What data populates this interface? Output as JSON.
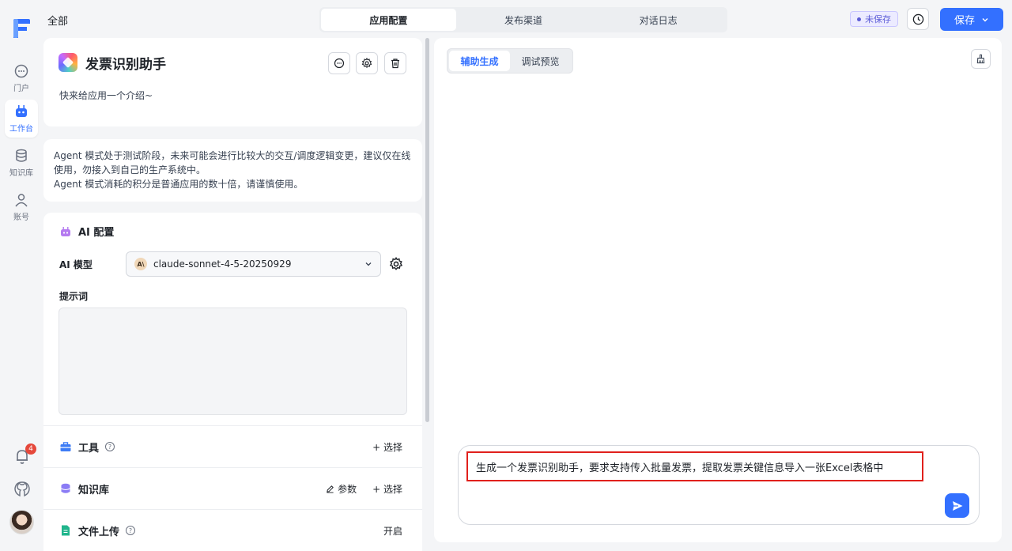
{
  "nav": {
    "items": [
      {
        "label": "门户",
        "icon": "chat-icon"
      },
      {
        "label": "工作台",
        "icon": "robot-icon"
      },
      {
        "label": "知识库",
        "icon": "database-icon"
      },
      {
        "label": "账号",
        "icon": "user-icon"
      }
    ],
    "notification_count": "4"
  },
  "header": {
    "breadcrumb": "全部",
    "tabs": [
      "应用配置",
      "发布渠道",
      "对话日志"
    ],
    "active_tab": "应用配置",
    "unsaved_label": "未保存",
    "save_label": "保存"
  },
  "app": {
    "title": "发票识别助手",
    "description": "快来给应用一个介绍~"
  },
  "notice": {
    "line1": "Agent 模式处于测试阶段，未来可能会进行比较大的交互/调度逻辑变更，建议仅在线使用，勿接入到自己的生产系统中。",
    "line2": "Agent 模式消耗的积分是普通应用的数十倍，请谨慎使用。"
  },
  "ai_config": {
    "title": "AI 配置",
    "model_label": "AI 模型",
    "model_logo": "A\\",
    "model_value": "claude-sonnet-4-5-20250929",
    "prompt_label": "提示词",
    "prompt_value": ""
  },
  "sections": {
    "tools": {
      "label": "工具",
      "help": "?",
      "action": "+ 选择"
    },
    "knowledge": {
      "label": "知识库",
      "params": "参数",
      "action": "+ 选择"
    },
    "file_upload": {
      "label": "文件上传",
      "help": "?",
      "action": "开启"
    }
  },
  "assistant": {
    "tabs": [
      "辅助生成",
      "调试预览"
    ],
    "active_tab": "辅助生成",
    "input_value": "生成一个发票识别助手，要求支持传入批量发票，提取发票关键信息导入一张Excel表格中"
  },
  "colors": {
    "accent": "#3370ff",
    "highlight_border": "#e0201c",
    "unsaved_badge": "#5b5bd6",
    "notification_badge": "#e5483b"
  }
}
